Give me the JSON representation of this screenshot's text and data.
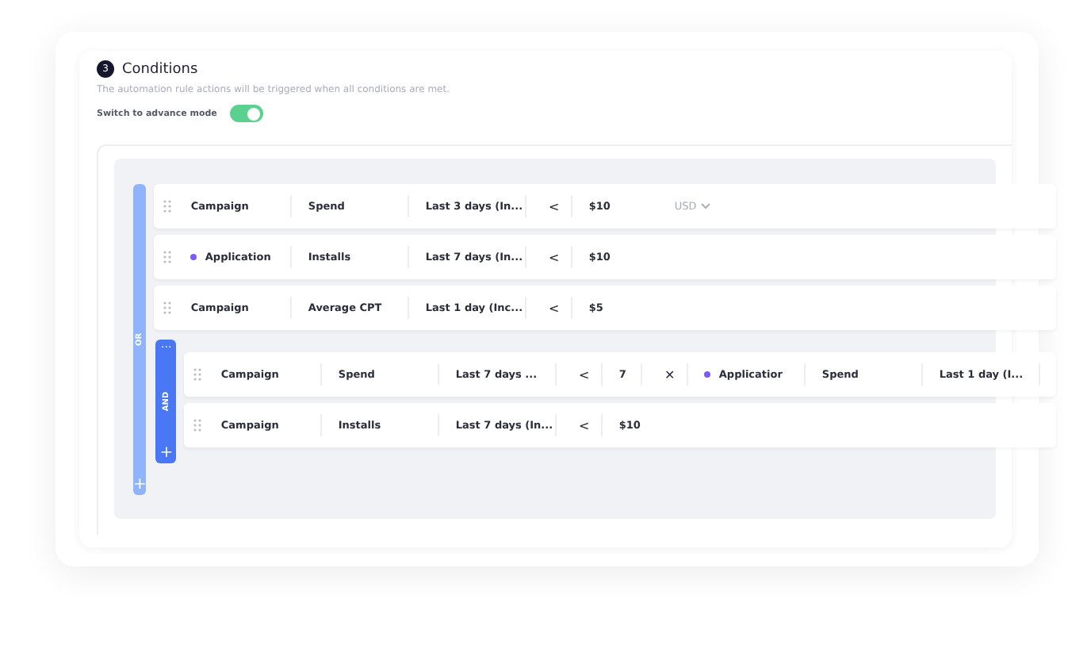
{
  "section": {
    "number": "3",
    "title": "Conditions",
    "description": "The automation rule actions will be triggered when all conditions are met.",
    "advance_mode": {
      "label": "Switch to advance mode",
      "on": true
    }
  },
  "or_group": {
    "label": "OR",
    "add": "+",
    "rows": [
      {
        "cells": [
          {
            "kind": "field",
            "text": "Campaign"
          },
          {
            "kind": "field",
            "text": "Spend"
          },
          {
            "kind": "field",
            "text": "Last 3 days (In..."
          },
          {
            "kind": "operator",
            "text": "<"
          },
          {
            "kind": "value",
            "text": "$10"
          },
          {
            "kind": "dropdown",
            "text": "USD"
          }
        ]
      },
      {
        "cells": [
          {
            "kind": "field",
            "text": "Application",
            "color": "#7c5cf2"
          },
          {
            "kind": "field",
            "text": "Installs"
          },
          {
            "kind": "field",
            "text": "Last 7 days (In..."
          },
          {
            "kind": "operator",
            "text": "<"
          },
          {
            "kind": "value",
            "text": "$10"
          }
        ]
      },
      {
        "cells": [
          {
            "kind": "field",
            "text": "Campaign"
          },
          {
            "kind": "field",
            "text": "Average CPT"
          },
          {
            "kind": "field",
            "text": "Last 1 day (Inc..."
          },
          {
            "kind": "operator",
            "text": "<"
          },
          {
            "kind": "value",
            "text": "$5"
          }
        ]
      }
    ],
    "and_group": {
      "label": "AND",
      "menu": "···",
      "add": "+",
      "rows": [
        {
          "cells": [
            {
              "kind": "field",
              "text": "Campaign"
            },
            {
              "kind": "field",
              "text": "Spend"
            },
            {
              "kind": "field",
              "text": "Last 7 days ..."
            },
            {
              "kind": "operator",
              "text": "<"
            },
            {
              "kind": "short",
              "text": "7"
            },
            {
              "kind": "operator",
              "text": "✕"
            },
            {
              "kind": "field",
              "text": "Applicatior",
              "color": "#7c5cf2"
            },
            {
              "kind": "field",
              "text": "Spend"
            },
            {
              "kind": "field",
              "text": "Last 1 day (I..."
            }
          ]
        },
        {
          "cells": [
            {
              "kind": "field",
              "text": "Campaign"
            },
            {
              "kind": "field",
              "text": "Installs"
            },
            {
              "kind": "field",
              "text": "Last 7 days (In..."
            },
            {
              "kind": "operator",
              "text": "<"
            },
            {
              "kind": "value",
              "text": "$10"
            }
          ]
        }
      ]
    }
  }
}
